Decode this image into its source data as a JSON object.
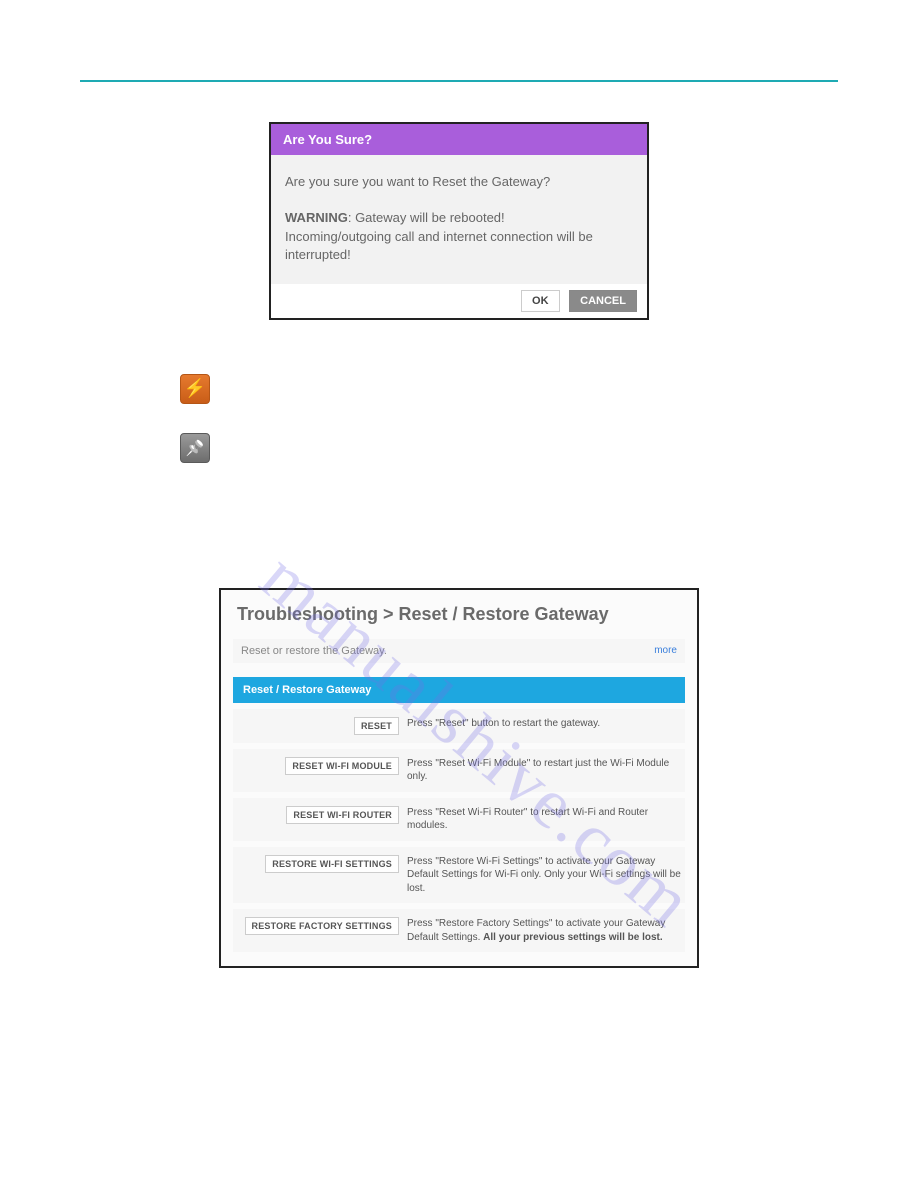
{
  "watermark": "manualshive.com",
  "dialog": {
    "title": "Are You Sure?",
    "question": "Are you sure you want to Reset the Gateway?",
    "warning_label": "WARNING",
    "warning_line1": ": Gateway will be rebooted!",
    "warning_line2": "Incoming/outgoing call and internet connection will be interrupted!",
    "ok": "OK",
    "cancel": "CANCEL"
  },
  "panel": {
    "title": "Troubleshooting > Reset / Restore Gateway",
    "subtitle": "Reset or restore the Gateway.",
    "more": "more",
    "section": "Reset / Restore Gateway",
    "rows": [
      {
        "button": "RESET",
        "desc": "Press \"Reset\" button to restart the gateway."
      },
      {
        "button": "RESET WI-FI MODULE",
        "desc": "Press \"Reset Wi-Fi Module\" to restart just the Wi-Fi Module only."
      },
      {
        "button": "RESET WI-FI ROUTER",
        "desc": "Press \"Reset Wi-Fi Router\" to restart Wi-Fi and Router modules."
      },
      {
        "button": "RESTORE WI-FI SETTINGS",
        "desc": "Press \"Restore Wi-Fi Settings\" to activate your Gateway Default Settings for Wi-Fi only. Only your Wi-Fi settings will be lost."
      },
      {
        "button": "RESTORE FACTORY SETTINGS",
        "desc_pre": "Press \"Restore Factory Settings\" to activate your Gateway Default Settings. ",
        "desc_bold": "All your previous settings will be lost."
      }
    ]
  }
}
